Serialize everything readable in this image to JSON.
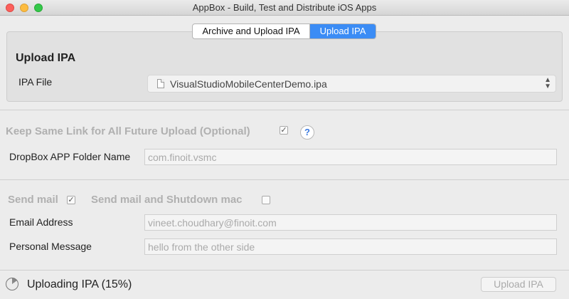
{
  "window": {
    "title": "AppBox - Build, Test and Distribute iOS Apps"
  },
  "tabs": {
    "archive_upload": "Archive and Upload IPA",
    "upload": "Upload IPA",
    "selected": "upload"
  },
  "upload_section": {
    "title": "Upload IPA",
    "ipa_label": "IPA File",
    "ipa_value": "VisualStudioMobileCenterDemo.ipa"
  },
  "link_section": {
    "keep_same_link_label": "Keep Same Link for All Future Upload (Optional)",
    "keep_same_link_checked": true,
    "help_glyph": "?",
    "folder_label": "DropBox APP Folder Name",
    "folder_value": "com.finoit.vsmc"
  },
  "mail_section": {
    "send_mail_label": "Send mail",
    "send_mail_checked": true,
    "shutdown_label": "Send mail and Shutdown mac",
    "shutdown_checked": false,
    "email_label": "Email Address",
    "email_value": "vineet.choudhary@finoit.com",
    "message_label": "Personal Message",
    "message_value": "hello from the other side"
  },
  "status": {
    "text": "Uploading IPA (15%)",
    "progress": 0.15,
    "button_label": "Upload IPA"
  },
  "colors": {
    "accent": "#3b8cf5",
    "disabled_text": "#b0b0b0"
  }
}
